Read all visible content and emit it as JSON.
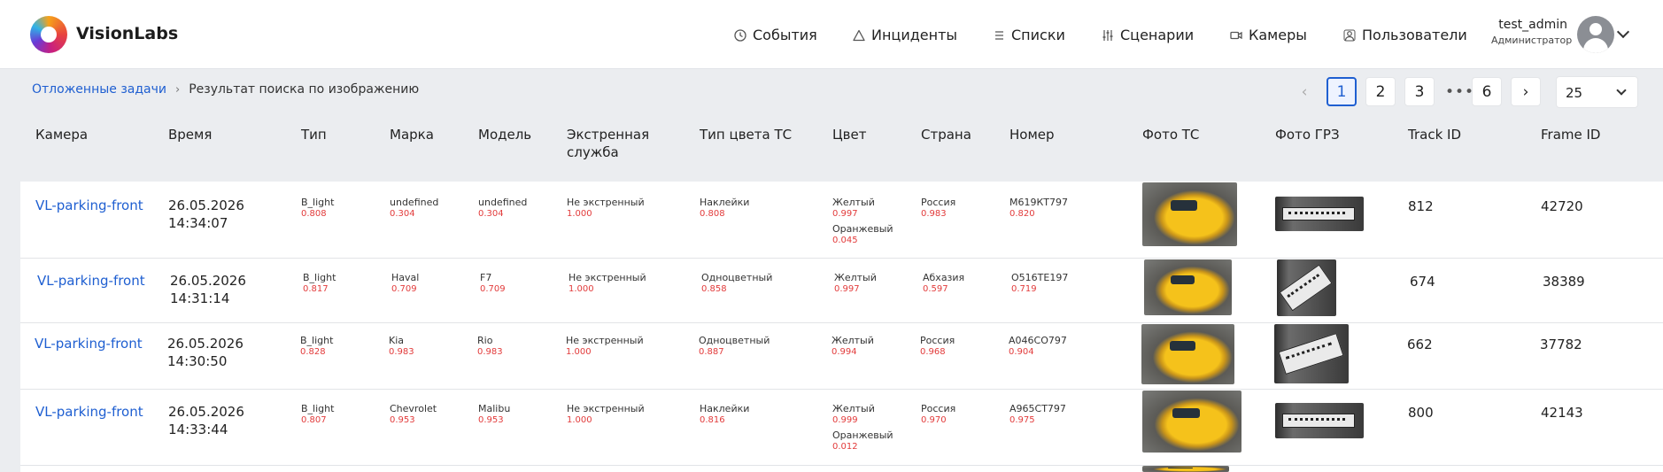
{
  "brand": "VisionLabs",
  "nav": [
    {
      "label": "События",
      "icon": "clock-icon"
    },
    {
      "label": "Инциденты",
      "icon": "warning-icon"
    },
    {
      "label": "Списки",
      "icon": "list-icon"
    },
    {
      "label": "Сценарии",
      "icon": "sliders-icon"
    },
    {
      "label": "Камеры",
      "icon": "camera-icon"
    },
    {
      "label": "Пользователи",
      "icon": "users-icon"
    }
  ],
  "user": {
    "name": "test_admin",
    "role": "Администратор"
  },
  "breadcrumb": {
    "parent": "Отложенные задачи",
    "current": "Результат поиска по изображению"
  },
  "pagination": {
    "pages": [
      "1",
      "2",
      "3",
      "6"
    ],
    "active": "1",
    "ellipsis": "•••",
    "page_size": "25"
  },
  "columns": [
    "Камера",
    "Время",
    "Тип",
    "Марка",
    "Модель",
    "Экстренная служба",
    "Тип цвета ТС",
    "Цвет",
    "Страна",
    "Номер",
    "Фото ТС",
    "Фото ГРЗ",
    "Track ID",
    "Frame ID"
  ],
  "rows": [
    {
      "camera": "VL-parking-front",
      "date": "26.05.2026",
      "time": "14:34:07",
      "type": "B_light",
      "type_score": "0.808",
      "brand": "undefined",
      "brand_score": "0.304",
      "model": "undefined",
      "model_score": "0.304",
      "emergency": "Не экстренный",
      "emergency_score": "1.000",
      "color_type": "Наклейки",
      "color_type_score": "0.808",
      "colors": [
        {
          "name": "Желтый",
          "score": "0.997"
        },
        {
          "name": "Оранжевый",
          "score": "0.045"
        }
      ],
      "country": "Россия",
      "country_score": "0.983",
      "plate": "М619КТ797",
      "plate_score": "0.820",
      "track_id": "812",
      "frame_id": "42720"
    },
    {
      "camera": "VL-parking-front",
      "date": "26.05.2026",
      "time": "14:31:14",
      "type": "B_light",
      "type_score": "0.817",
      "brand": "Haval",
      "brand_score": "0.709",
      "model": "F7",
      "model_score": "0.709",
      "emergency": "Не экстренный",
      "emergency_score": "1.000",
      "color_type": "Одноцветный",
      "color_type_score": "0.858",
      "colors": [
        {
          "name": "Желтый",
          "score": "0.997"
        }
      ],
      "country": "Абхазия",
      "country_score": "0.597",
      "plate": "О516ТЕ197",
      "plate_score": "0.719",
      "track_id": "674",
      "frame_id": "38389"
    },
    {
      "camera": "VL-parking-front",
      "date": "26.05.2026",
      "time": "14:30:50",
      "type": "B_light",
      "type_score": "0.828",
      "brand": "Kia",
      "brand_score": "0.983",
      "model": "Rio",
      "model_score": "0.983",
      "emergency": "Не экстренный",
      "emergency_score": "1.000",
      "color_type": "Одноцветный",
      "color_type_score": "0.887",
      "colors": [
        {
          "name": "Желтый",
          "score": "0.994"
        }
      ],
      "country": "Россия",
      "country_score": "0.968",
      "plate": "А046СО797",
      "plate_score": "0.904",
      "track_id": "662",
      "frame_id": "37782"
    },
    {
      "camera": "VL-parking-front",
      "date": "26.05.2026",
      "time": "14:33:44",
      "type": "B_light",
      "type_score": "0.807",
      "brand": "Chevrolet",
      "brand_score": "0.953",
      "model": "Malibu",
      "model_score": "0.953",
      "emergency": "Не экстренный",
      "emergency_score": "1.000",
      "color_type": "Наклейки",
      "color_type_score": "0.816",
      "colors": [
        {
          "name": "Желтый",
          "score": "0.999"
        },
        {
          "name": "Оранжевый",
          "score": "0.012"
        }
      ],
      "country": "Россия",
      "country_score": "0.970",
      "plate": "А965СТ797",
      "plate_score": "0.975",
      "track_id": "800",
      "frame_id": "42143"
    }
  ]
}
